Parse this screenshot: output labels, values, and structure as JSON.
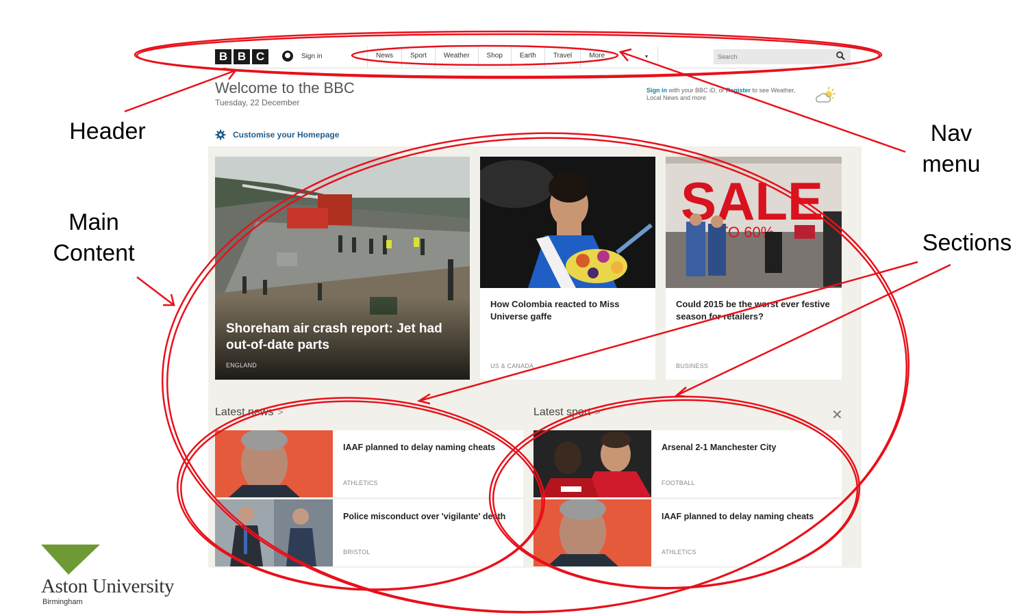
{
  "header": {
    "logo_letters": [
      "B",
      "B",
      "C"
    ],
    "signin_label": "Sign in",
    "nav_items": [
      "News",
      "Sport",
      "Weather",
      "Shop",
      "Earth",
      "Travel",
      "More"
    ],
    "nav_caret": "▾",
    "search_placeholder": "Search"
  },
  "welcome": {
    "title": "Welcome to the BBC",
    "date": "Tuesday, 22 December"
  },
  "signin_promo": {
    "signin_link": "Sign in",
    "middle_text": " with your BBC iD, or ",
    "register_link": "Register",
    "end_text": " to see Weather, Local News and more"
  },
  "customise_label": "Customise your Homepage",
  "top_stories": [
    {
      "title": "Shoreham air crash report: Jet had out-of-date parts",
      "tag": "ENGLAND"
    },
    {
      "title": "How Colombia reacted to Miss Universe gaffe",
      "tag": "US & CANADA"
    },
    {
      "title": "Could 2015 be the worst ever festive season for retailers?",
      "tag": "BUSINESS"
    }
  ],
  "latest_news": {
    "heading": "Latest news",
    "items": [
      {
        "title": "IAAF planned to delay naming cheats",
        "tag": "ATHLETICS"
      },
      {
        "title": "Police misconduct over 'vigilante' death",
        "tag": "BRISTOL"
      }
    ]
  },
  "latest_sport": {
    "heading": "Latest sport",
    "items": [
      {
        "title": "Arsenal 2-1 Manchester City",
        "tag": "FOOTBALL"
      },
      {
        "title": "IAAF planned to delay naming cheats",
        "tag": "ATHLETICS"
      }
    ]
  },
  "section_chevron": ">",
  "close_glyph": "✕",
  "annotations": {
    "header": "Header",
    "nav_menu_line1": "Nav",
    "nav_menu_line2": "menu",
    "main_content_line1": "Main",
    "main_content_line2": "Content",
    "sections": "Sections"
  },
  "footer_logo": {
    "name": "Aston University",
    "city": "Birmingham"
  },
  "colors": {
    "annotation_red": "#e8101a",
    "link_blue": "#1380a1",
    "content_background": "#f1f0ea",
    "aston_green": "#6e9a35"
  }
}
